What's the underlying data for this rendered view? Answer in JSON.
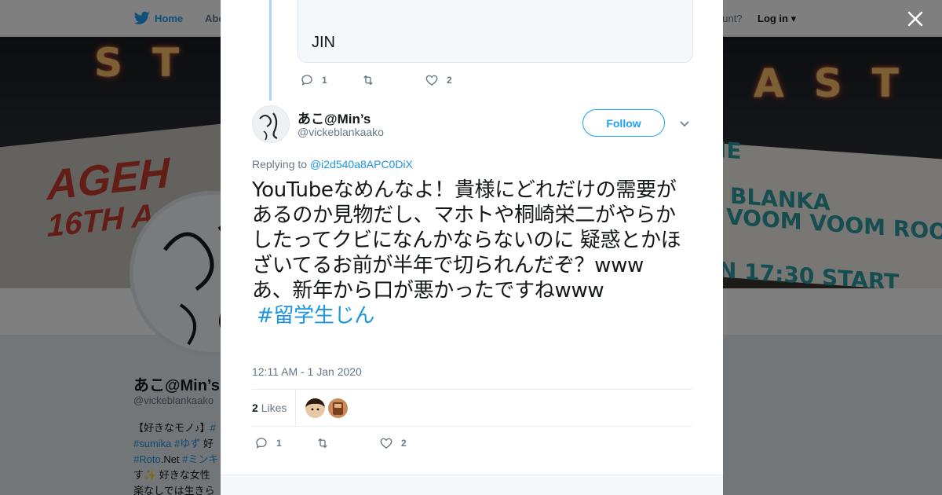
{
  "topbar": {
    "home_label": "Home",
    "about_label": "Abo",
    "account_prompt": "ccount?",
    "login_label": "Log in"
  },
  "banner": {
    "marquee_left": "ST",
    "marquee_right": "AST",
    "venue": "AGEH",
    "venue_sub": "16TH A",
    "right_line1": "IE",
    "right_line2": "BLANKA",
    "right_line3": "VOOM VOOM ROO",
    "right_line4": "N 17:30  START"
  },
  "profile": {
    "name": "あこ@Min’s",
    "handle": "@vickeblankaako",
    "bio_line1_prefix": "【好きなモノ♪】",
    "bio_line1_tag": "#",
    "bio_line2_tag1": "#sumika",
    "bio_line2_tag2": "#ゆず",
    "bio_line2_suffix": " 好",
    "bio_line3_tag": "#Roto",
    "bio_line3_mid": ".Net ",
    "bio_line3_tag2": "#ミンキ",
    "bio_line4": "す✨ 好きな女性",
    "bio_line5": "楽なしでは生きら"
  },
  "quoted": {
    "text": "JIN"
  },
  "parent_actions": {
    "reply_count": "1",
    "retweet_count": "",
    "like_count": "2"
  },
  "tweet": {
    "author_name": "あこ@Min’s",
    "author_handle": "@vickeblankaako",
    "follow_label": "Follow",
    "replying_prefix": "Replying to ",
    "replying_handle": "@i2d540a8APC0DiX",
    "text": "YouTubeなめんなよ！貴様にどれだけの需要があるのか見物だし、マホトや桐崎栄二がやらかしたってクビになんかならないのに 疑惑とかほざいてるお前が半年で切られんだぞ？www\nあ、新年から口が悪かったですねwww",
    "hashtag": "#留学生じん",
    "timestamp": "12:11 AM - 1 Jan 2020",
    "likes_number": "2",
    "likes_label": "Likes",
    "reply_count": "1",
    "retweet_count": "",
    "like_count": "2"
  },
  "colors": {
    "brand": "#1da1f2",
    "link": "#1b95e0",
    "muted": "#657786",
    "thread": "#a6d6f5"
  },
  "icons": [
    "twitter-bird-icon",
    "close-icon",
    "reply-icon",
    "retweet-icon",
    "heart-icon",
    "chevron-down-icon"
  ]
}
